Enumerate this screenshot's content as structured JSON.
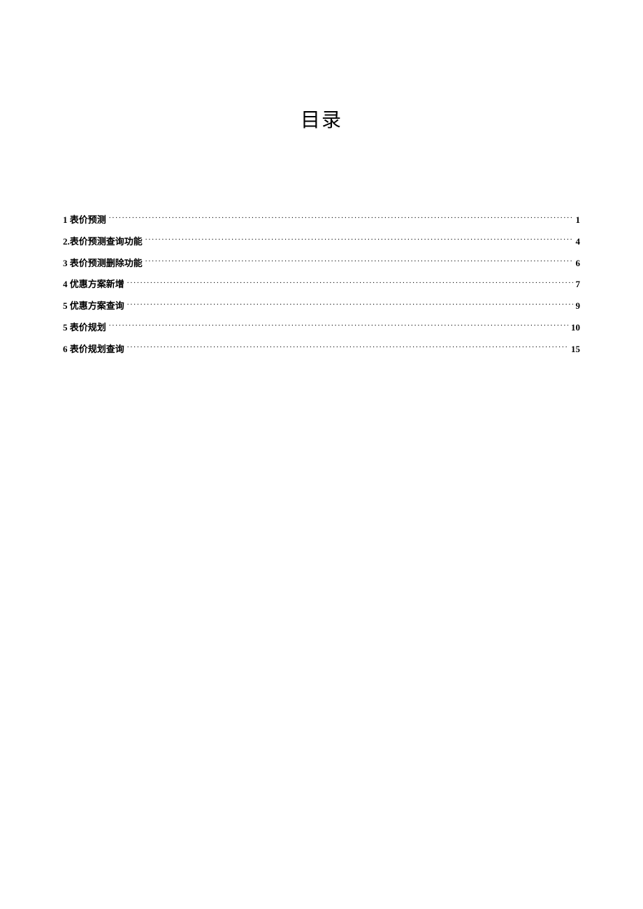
{
  "title": "目录",
  "toc": [
    {
      "label": "1 表价预测",
      "page": "1"
    },
    {
      "label": "2.表价预测查询功能",
      "page": "4"
    },
    {
      "label": "3 表价预测删除功能",
      "page": "6"
    },
    {
      "label": "4 优惠方案新增",
      "page": "7"
    },
    {
      "label": "5 优惠方案查询",
      "page": "9"
    },
    {
      "label": "5 表价规划",
      "page": "10"
    },
    {
      "label": "6 表价规划查询",
      "page": "15"
    }
  ]
}
